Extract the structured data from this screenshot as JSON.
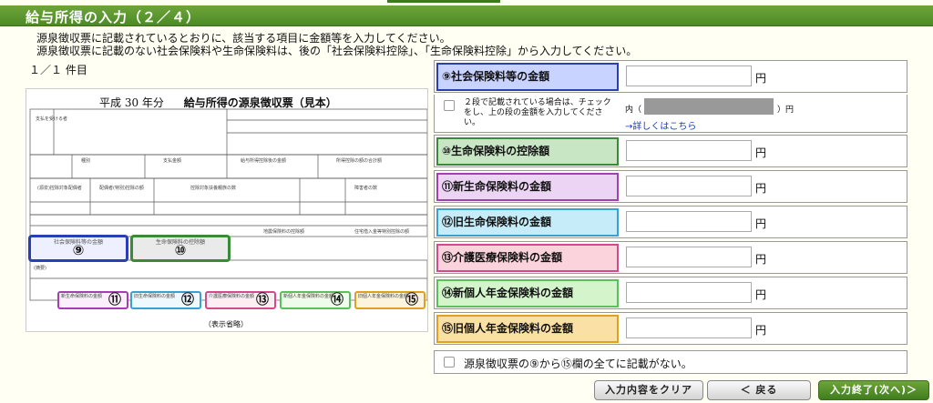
{
  "header": {
    "title": "給与所得の入力（２／４）"
  },
  "instructions": [
    "源泉徴収票に記載されているとおりに、該当する項目に金額等を入力してください。",
    "源泉徴収票に記載のない社会保険料や生命保険料は、後の「社会保険料控除」、「生命保険料控除」から入力してください。"
  ],
  "count": {
    "text": "１／１ 件目"
  },
  "slip": {
    "title_year": "平成 30 年分",
    "title_main": "給与所得の源泉徴収票（見本）",
    "marks": [
      {
        "num": "⑨",
        "label": "社会保険料等の金額",
        "color": "#2b3fb5"
      },
      {
        "num": "⑩",
        "label": "生命保険料の控除額",
        "color": "#3a8a3a"
      },
      {
        "num": "⑪",
        "label": "新生命保険料の金額",
        "color": "#a33fb0"
      },
      {
        "num": "⑫",
        "label": "旧生命保険料の金額",
        "color": "#3aa0cf"
      },
      {
        "num": "⑬",
        "label": "介護医療保険料の金額",
        "color": "#d44a8a"
      },
      {
        "num": "⑭",
        "label": "新個人年金保険料の金額",
        "color": "#5cbf5c"
      },
      {
        "num": "⑮",
        "label": "旧個人年金保険料の金額",
        "color": "#e0a020"
      }
    ],
    "omitted": "（表示省略）"
  },
  "form": {
    "rows": [
      {
        "label": "⑨社会保険料等の金額",
        "value": "",
        "unit": "円",
        "bg": "#c9d3ff",
        "border": "#2b3fb5"
      },
      {
        "label": "⑩生命保険料の控除額",
        "value": "",
        "unit": "円",
        "bg": "#c8e6c4",
        "border": "#3a8a3a"
      },
      {
        "label": "⑪新生命保険料の金額",
        "value": "",
        "unit": "円",
        "bg": "#ecd4f4",
        "border": "#a33fb0"
      },
      {
        "label": "⑫旧生命保険料の金額",
        "value": "",
        "unit": "円",
        "bg": "#c5ecf8",
        "border": "#3aa0cf"
      },
      {
        "label": "⑬介護医療保険料の金額",
        "value": "",
        "unit": "円",
        "bg": "#fad3dc",
        "border": "#d44a8a"
      },
      {
        "label": "⑭新個人年金保険料の金額",
        "value": "",
        "unit": "円",
        "bg": "#d4f4cc",
        "border": "#5cbf5c"
      },
      {
        "label": "⑮旧個人年金保険料の金額",
        "value": "",
        "unit": "円",
        "bg": "#fbe0a6",
        "border": "#e0a020"
      }
    ],
    "sub": {
      "checkbox_text": "２段で記載されている場合は、チェックをし、上の段の金額を入力してください。",
      "uchi_open": "内（",
      "uchi_close": "）円",
      "link": "→詳しくはこちら"
    },
    "none_checkbox": "源泉徴収票の⑨から⑮欄の全てに記載がない。"
  },
  "buttons": {
    "clear": "入力内容をクリア",
    "back": "＜ 戻る",
    "finish": "入力終了(次へ)＞"
  }
}
